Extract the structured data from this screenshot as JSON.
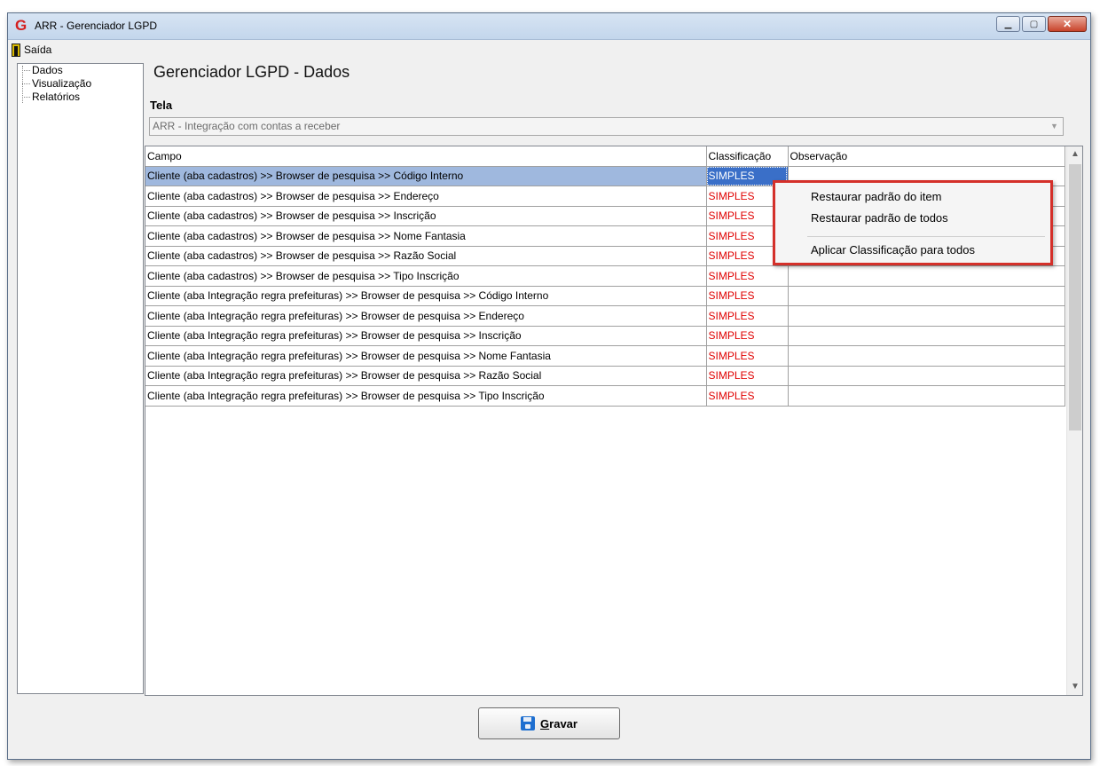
{
  "window": {
    "title": "ARR - Gerenciador LGPD"
  },
  "menu": {
    "exit_label": "Saída"
  },
  "sidebar": {
    "items": [
      {
        "label": "Dados"
      },
      {
        "label": "Visualização"
      },
      {
        "label": "Relatórios"
      }
    ]
  },
  "main": {
    "heading": "Gerenciador LGPD - Dados",
    "tela_label": "Tela",
    "tela_value": "ARR - Integração com contas a receber"
  },
  "grid": {
    "columns": [
      "Campo",
      "Classificação",
      "Observação"
    ],
    "rows": [
      {
        "campo": "Cliente (aba cadastros) >> Browser de pesquisa >> Código Interno",
        "classificacao": "SIMPLES",
        "observacao": ""
      },
      {
        "campo": "Cliente (aba cadastros) >> Browser de pesquisa >> Endereço",
        "classificacao": "SIMPLES",
        "observacao": ""
      },
      {
        "campo": "Cliente (aba cadastros) >> Browser de pesquisa >> Inscrição",
        "classificacao": "SIMPLES",
        "observacao": ""
      },
      {
        "campo": "Cliente (aba cadastros) >> Browser de pesquisa >> Nome Fantasia",
        "classificacao": "SIMPLES",
        "observacao": ""
      },
      {
        "campo": "Cliente (aba cadastros) >> Browser de pesquisa >> Razão Social",
        "classificacao": "SIMPLES",
        "observacao": ""
      },
      {
        "campo": "Cliente (aba cadastros) >> Browser de pesquisa >> Tipo Inscrição",
        "classificacao": "SIMPLES",
        "observacao": ""
      },
      {
        "campo": "Cliente (aba Integração regra prefeituras) >> Browser de pesquisa >> Código Interno",
        "classificacao": "SIMPLES",
        "observacao": ""
      },
      {
        "campo": "Cliente (aba Integração regra prefeituras) >> Browser de pesquisa >> Endereço",
        "classificacao": "SIMPLES",
        "observacao": ""
      },
      {
        "campo": "Cliente (aba Integração regra prefeituras) >> Browser de pesquisa >> Inscrição",
        "classificacao": "SIMPLES",
        "observacao": ""
      },
      {
        "campo": "Cliente (aba Integração regra prefeituras) >> Browser de pesquisa >> Nome Fantasia",
        "classificacao": "SIMPLES",
        "observacao": ""
      },
      {
        "campo": "Cliente (aba Integração regra prefeituras) >> Browser de pesquisa >> Razão Social",
        "classificacao": "SIMPLES",
        "observacao": ""
      },
      {
        "campo": "Cliente (aba Integração regra prefeituras) >> Browser de pesquisa >> Tipo Inscrição",
        "classificacao": "SIMPLES",
        "observacao": ""
      }
    ]
  },
  "context_menu": {
    "items": [
      {
        "label": "Restaurar padrão do item"
      },
      {
        "label": "Restaurar padrão de todos"
      },
      {
        "label": "Aplicar Classificação para todos"
      }
    ]
  },
  "footer": {
    "save_label": "Gravar",
    "save_accelerator": "G",
    "save_rest": "ravar"
  },
  "colors": {
    "classification_text": "#e00000",
    "selection": "#3a6fc8",
    "context_menu_border": "#d4302a"
  },
  "icons": {
    "app": "app-logo-icon",
    "exit": "exit-door-icon",
    "save": "floppy-disk-icon",
    "scroll_up": "chevron-up-icon",
    "scroll_down": "chevron-down-icon",
    "combo": "dropdown-arrow-icon"
  }
}
